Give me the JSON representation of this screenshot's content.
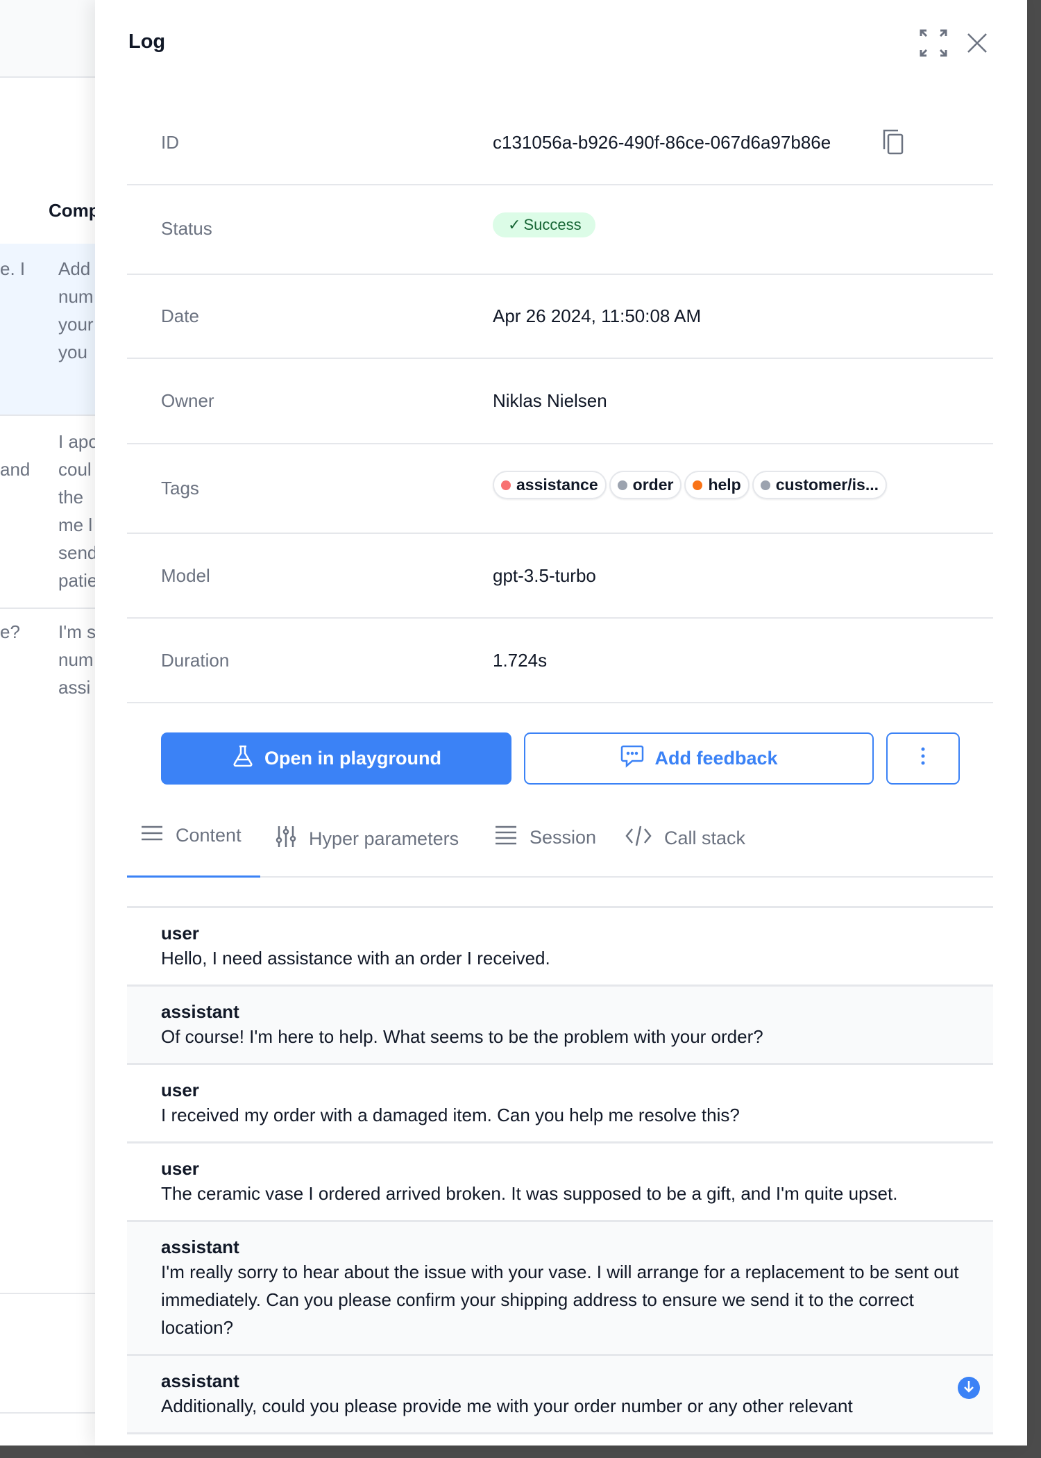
{
  "background": {
    "column_header": "Comp",
    "rows": [
      {
        "left": [
          "e. I"
        ],
        "right": [
          "Add",
          "num",
          "your",
          "you"
        ]
      },
      {
        "left": [
          "and"
        ],
        "right": [
          "I apo",
          "coul",
          "the",
          "me l",
          "send",
          "patie"
        ]
      },
      {
        "left": [
          "e?"
        ],
        "right": [
          "I'm s",
          "num",
          "assi"
        ]
      }
    ]
  },
  "panel": {
    "title": "Log",
    "fields": [
      {
        "label": "ID",
        "value": "c131056a-b926-490f-86ce-067d6a97b86e"
      },
      {
        "label": "Status",
        "value": "Success"
      },
      {
        "label": "Date",
        "value": "Apr 26 2024, 11:50:08 AM"
      },
      {
        "label": "Owner",
        "value": "Niklas Nielsen"
      },
      {
        "label": "Tags"
      },
      {
        "label": "Model",
        "value": "gpt-3.5-turbo"
      },
      {
        "label": "Duration",
        "value": "1.724s"
      }
    ],
    "tags": [
      {
        "label": "assistance",
        "color": "#f87171"
      },
      {
        "label": "order",
        "color": "#9ca3af"
      },
      {
        "label": "help",
        "color": "#f97316"
      },
      {
        "label": "customer/is...",
        "color": "#9ca3af"
      }
    ],
    "buttons": {
      "playground": "Open in playground",
      "feedback": "Add feedback"
    },
    "tabs": [
      {
        "label": "Content",
        "icon": "menu-icon",
        "active": true
      },
      {
        "label": "Hyper parameters",
        "icon": "sliders-icon"
      },
      {
        "label": "Session",
        "icon": "list-icon"
      },
      {
        "label": "Call stack",
        "icon": "code-icon"
      }
    ],
    "messages": [
      {
        "role": "user",
        "text": "Hello, I need assistance with an order I received."
      },
      {
        "role": "assistant",
        "text": "Of course! I'm here to help. What seems to be the problem with your order?"
      },
      {
        "role": "user",
        "text": "I received my order with a damaged item. Can you help me resolve this?"
      },
      {
        "role": "user",
        "text": "The ceramic vase I ordered arrived broken. It was supposed to be a gift, and I'm quite upset."
      },
      {
        "role": "assistant",
        "text": "I'm really sorry to hear about the issue with your vase. I will arrange for a replacement to be sent out immediately. Can you please confirm your shipping address to ensure we send it to the correct location?"
      },
      {
        "role": "assistant",
        "text": "Additionally, could you please provide me with your order number or any other relevant"
      }
    ],
    "accent": "#3b82f6"
  }
}
